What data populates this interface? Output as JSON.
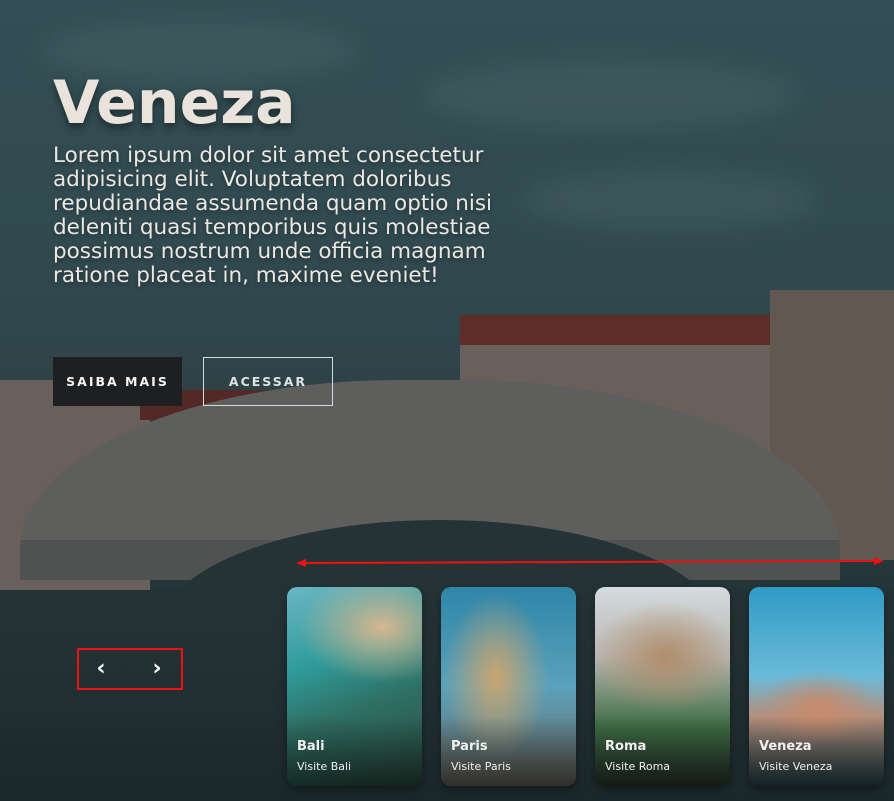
{
  "hero": {
    "title": "Veneza",
    "description": "Lorem ipsum dolor sit amet consectetur adipisicing elit. Voluptatem doloribus repudiandae assumenda quam optio nisi deleniti quasi temporibus quis molestiae possimus nostrum unde officia magnam ratione placeat in, maxime eveniet!",
    "buttons": {
      "primary": "SAIBA MAIS",
      "secondary": "ACESSAR"
    }
  },
  "slider": {
    "prev": "‹",
    "next": "›",
    "cards": [
      {
        "name": "Bali",
        "subtitle": "Visite Bali"
      },
      {
        "name": "Paris",
        "subtitle": "Visite Paris"
      },
      {
        "name": "Roma",
        "subtitle": "Visite Roma"
      },
      {
        "name": "Veneza",
        "subtitle": "Visite Veneza"
      }
    ]
  },
  "colors": {
    "annotation_red": "#ee1111",
    "primary_button_bg": "#1e1f20"
  }
}
